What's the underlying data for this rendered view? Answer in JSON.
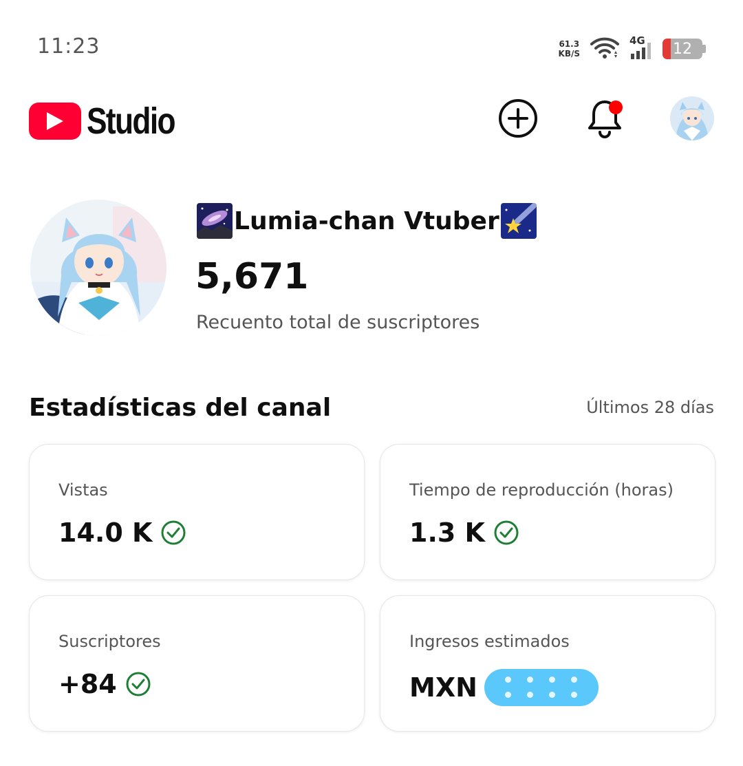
{
  "status_bar": {
    "time": "11:23",
    "net_speed_value": "61.3",
    "net_speed_unit": "KB/S",
    "network_type": "4G",
    "battery_level": "12",
    "battery_fraction": 0.12,
    "battery_color": "#e53935"
  },
  "header": {
    "app_name": "Studio",
    "brand_color": "#ff0033",
    "icons": [
      "youtube-logo-icon",
      "create-plus-icon",
      "bell-icon",
      "account-avatar"
    ],
    "has_notification_dot": true
  },
  "channel": {
    "name": "Lumia-chan Vtuber",
    "subscriber_count": "5,671",
    "subscriber_label": "Recuento total de suscriptores"
  },
  "stats": {
    "title": "Estadísticas del canal",
    "period": "Últimos 28 días",
    "cards": [
      {
        "label": "Vistas",
        "value": "14.0 K",
        "verified": true
      },
      {
        "label": "Tiempo de reproducción (horas)",
        "value": "1.3 K",
        "verified": true
      },
      {
        "label": "Suscriptores",
        "value": "+84",
        "verified": true
      },
      {
        "label": "Ingresos estimados",
        "value": "MXN",
        "redacted": true
      }
    ],
    "check_color": "#1e7e34"
  }
}
